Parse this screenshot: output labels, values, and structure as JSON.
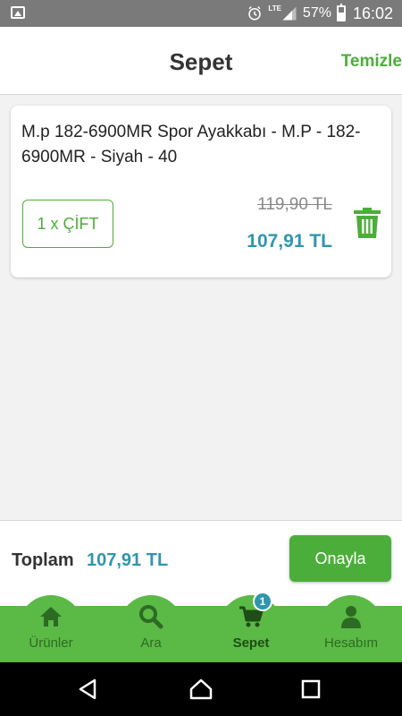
{
  "status_bar": {
    "network": "LTE",
    "battery": "57%",
    "time": "16:02"
  },
  "header": {
    "title": "Sepet",
    "clear_label": "Temizle"
  },
  "cart": {
    "items": [
      {
        "name": "M.p 182-6900MR Spor Ayakkabı - M.P - 182-6900MR - Siyah - 40",
        "quantity": "1 x ÇİFT",
        "old_price": "119,90 TL",
        "price": "107,91 TL"
      }
    ]
  },
  "total": {
    "label": "Toplam",
    "amount": "107,91 TL",
    "confirm_label": "Onayla"
  },
  "tabs": [
    {
      "label": "Ürünler",
      "icon": "home-icon"
    },
    {
      "label": "Ara",
      "icon": "search-icon"
    },
    {
      "label": "Sepet",
      "icon": "cart-icon",
      "badge": "1"
    },
    {
      "label": "Hesabım",
      "icon": "user-icon"
    }
  ],
  "colors": {
    "accent": "#4cae3a",
    "tabbar": "#5bb946",
    "price": "#2f96ad"
  }
}
